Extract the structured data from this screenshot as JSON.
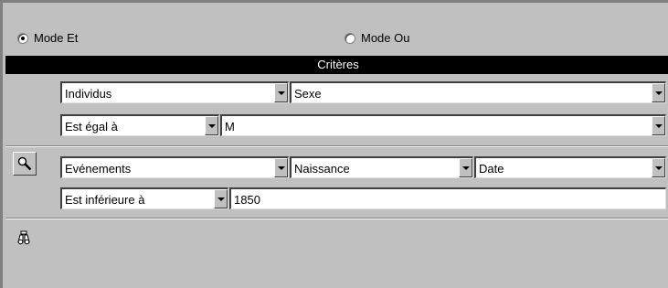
{
  "mode": {
    "and_label": "Mode Et",
    "or_label": "Mode Ou",
    "selected": "and"
  },
  "criteria_header": "Critères",
  "criteria": [
    {
      "icon": "none",
      "row1": [
        "Individus",
        "Sexe"
      ],
      "operator": "Est égal à",
      "value": "M"
    },
    {
      "icon": "search-icon",
      "row1": [
        "Evénements",
        "Naissance",
        "Date"
      ],
      "operator": "Est inférieure à",
      "value": "1850"
    }
  ],
  "add_icon": "binoculars-icon"
}
